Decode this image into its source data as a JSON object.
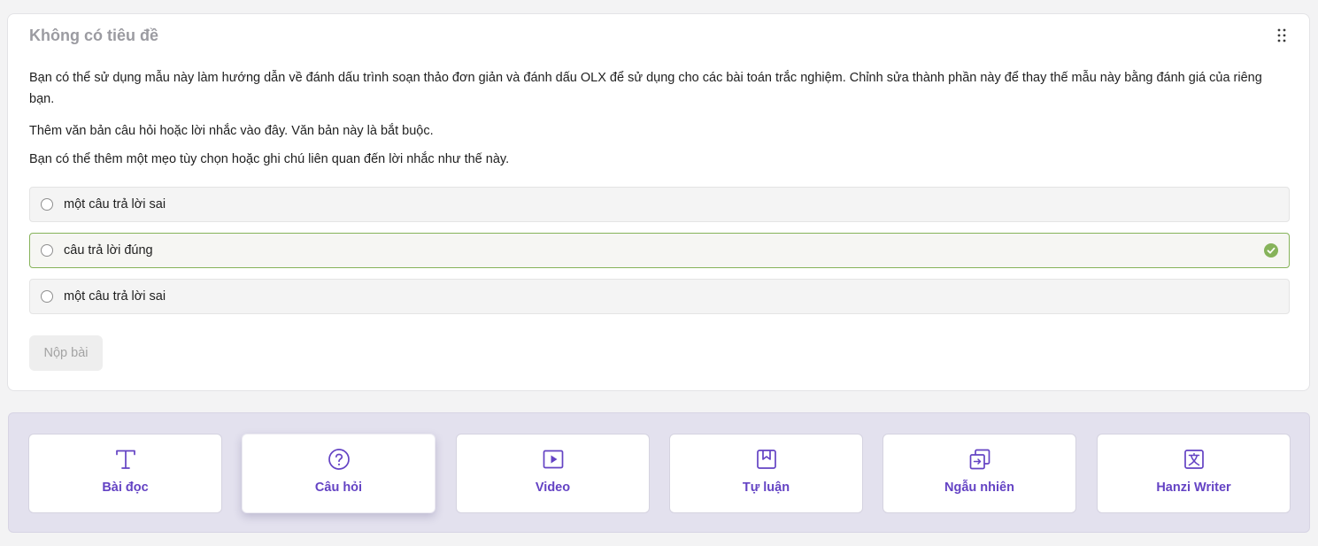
{
  "block": {
    "title": "Không có tiêu đề",
    "paragraphs": [
      "Bạn có thể sử dụng mẫu này làm hướng dẫn về đánh dấu trình soạn thảo đơn giản và đánh dấu OLX để sử dụng cho các bài toán trắc nghiệm. Chỉnh sửa thành phần này để thay thế mẫu này bằng đánh giá của riêng bạn.",
      "Thêm văn bản câu hỏi hoặc lời nhắc vào đây. Văn bản này là bắt buộc.",
      "Bạn có thể thêm một mẹo tùy chọn hoặc ghi chú liên quan đến lời nhắc như thế này."
    ],
    "options": [
      {
        "label": "một câu trả lời sai",
        "correct": false
      },
      {
        "label": "câu trả lời đúng",
        "correct": true
      },
      {
        "label": "một câu trả lời sai",
        "correct": false
      }
    ],
    "submit_label": "Nộp bài"
  },
  "toolbar": {
    "items": [
      {
        "label": "Bài đọc",
        "icon": "text-icon"
      },
      {
        "label": "Câu hỏi",
        "icon": "question-circle-icon",
        "active": true
      },
      {
        "label": "Video",
        "icon": "play-video-icon"
      },
      {
        "label": "Tự luận",
        "icon": "bookmark-icon"
      },
      {
        "label": "Ngẫu nhiên",
        "icon": "shuffle-icon"
      },
      {
        "label": "Hanzi Writer",
        "icon": "translate-icon"
      }
    ]
  },
  "colors": {
    "accent": "#6443c4",
    "correct": "#86b35a",
    "toolbar_bg": "#e3e1ee"
  }
}
